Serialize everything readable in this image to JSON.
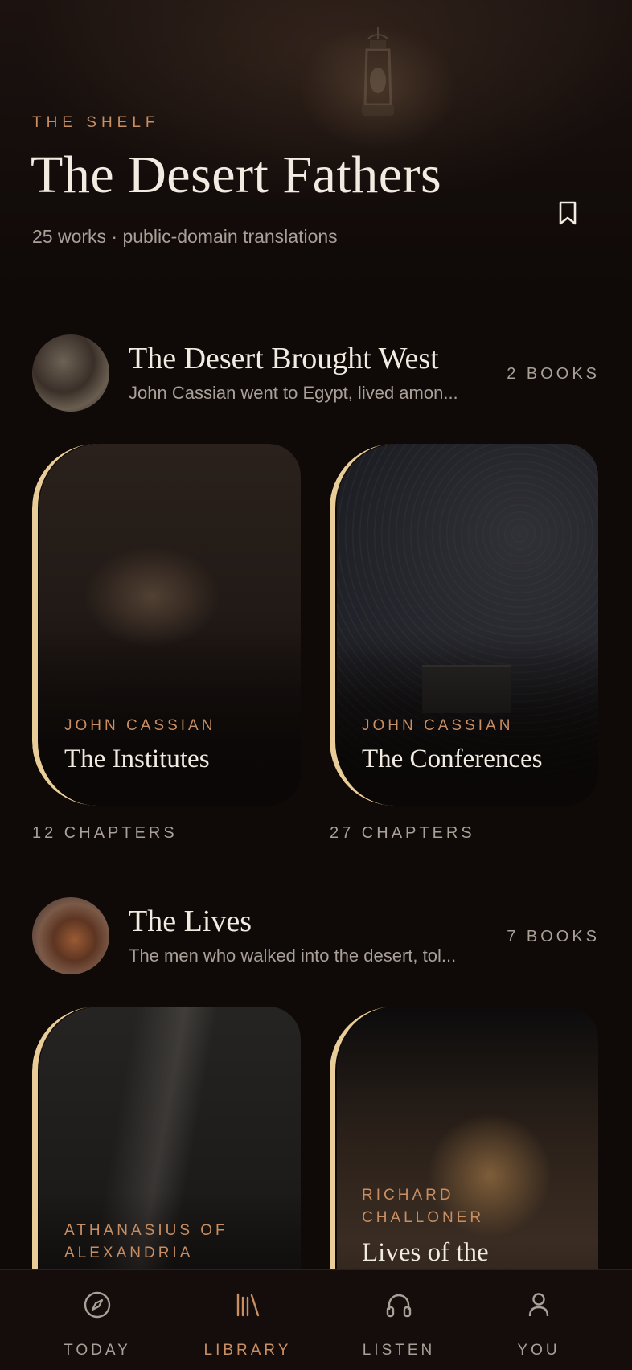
{
  "header": {
    "eyebrow": "THE SHELF",
    "title": "The Desert Fathers",
    "subtitle": "25 works · public-domain translations",
    "bookmark_icon": "bookmark-icon"
  },
  "sections": [
    {
      "title": "The Desert Brought West",
      "description": "John Cassian went to Egypt, lived amon...",
      "count": "2 BOOKS",
      "books": [
        {
          "author": "JOHN CASSIAN",
          "title": "The Institutes",
          "meta": "12 CHAPTERS"
        },
        {
          "author": "JOHN CASSIAN",
          "title": "The Conferences",
          "meta": "27 CHAPTERS"
        }
      ]
    },
    {
      "title": "The Lives",
      "description": "The men who walked into the desert, tol...",
      "count": "7 BOOKS",
      "books": [
        {
          "author_line1": "ATHANASIUS OF",
          "author_line2": "ALEXANDRIA"
        },
        {
          "author_line1": "RICHARD",
          "author_line2": "CHALLONER",
          "title": "Lives of the"
        }
      ]
    }
  ],
  "nav": {
    "items": [
      {
        "label": "TODAY",
        "icon": "compass-icon",
        "active": false
      },
      {
        "label": "LIBRARY",
        "icon": "library-icon",
        "active": true
      },
      {
        "label": "LISTEN",
        "icon": "headphones-icon",
        "active": false
      },
      {
        "label": "YOU",
        "icon": "user-icon",
        "active": false
      }
    ]
  },
  "colors": {
    "background": "#0f0908",
    "accent": "#c98e62",
    "card_edge": "#e9cd98",
    "text_primary": "#f1ebe2",
    "text_muted": "#a9a098"
  }
}
